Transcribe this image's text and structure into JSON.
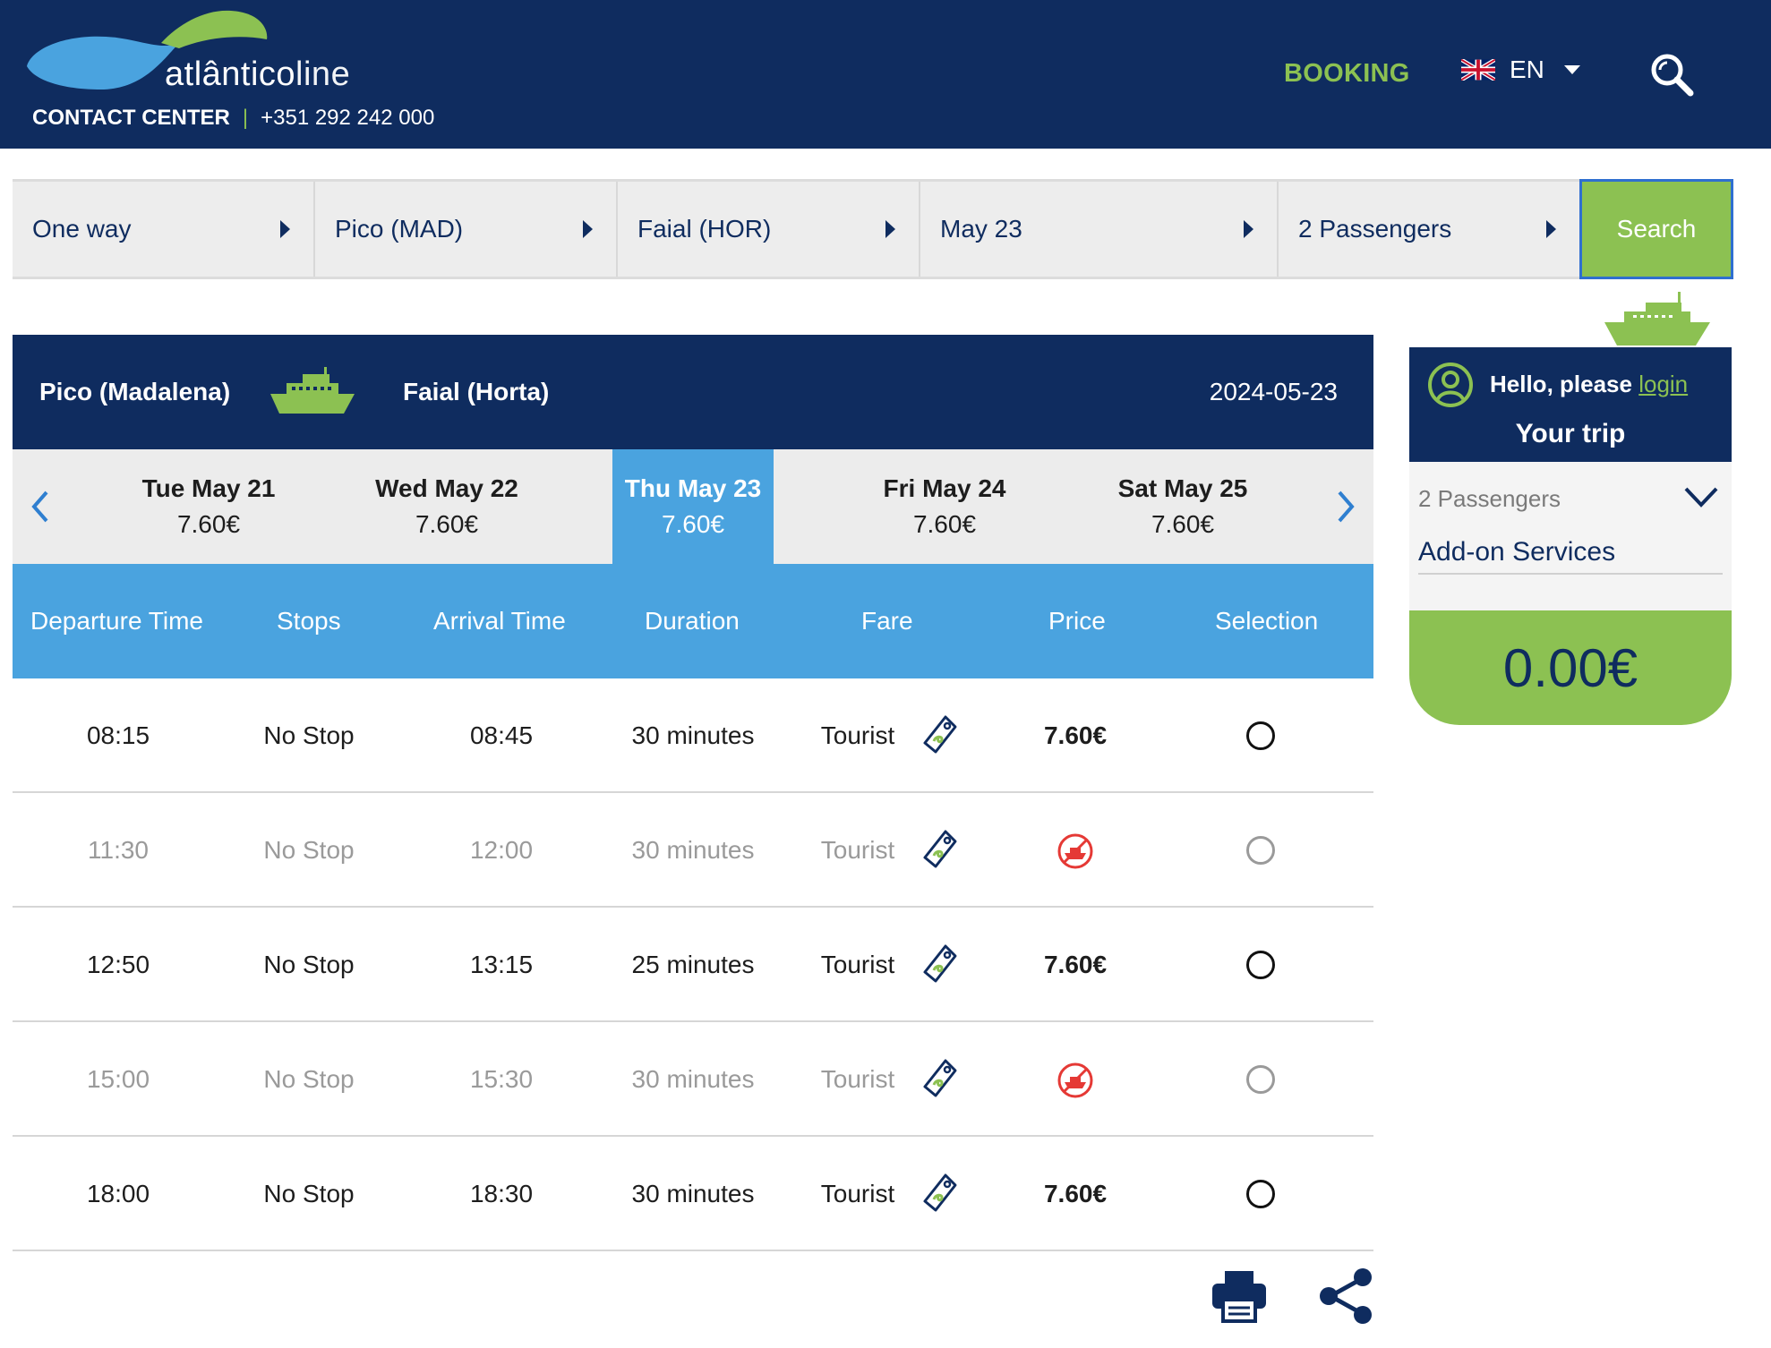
{
  "brand": {
    "logo_main": "atlântico",
    "logo_sub": "line"
  },
  "header": {
    "contact_label": "CONTACT CENTER",
    "contact_separator": "|",
    "contact_phone": "+351 292 242 000",
    "booking_label": "BOOKING",
    "language": "EN",
    "colors": {
      "navy": "#0f2c5f",
      "green": "#8cc152",
      "blue": "#4aa3df"
    }
  },
  "search_bar": {
    "trip_type": "One way",
    "origin": "Pico (MAD)",
    "destination": "Faial (HOR)",
    "date": "May 23",
    "passengers": "2 Passengers",
    "search_label": "Search"
  },
  "route": {
    "from": "Pico (Madalena)",
    "to": "Faial (Horta)",
    "date": "2024-05-23"
  },
  "dates": [
    {
      "day": "Tue May 21",
      "price": "7.60€",
      "active": false
    },
    {
      "day": "Wed May 22",
      "price": "7.60€",
      "active": false
    },
    {
      "day": "Thu May 23",
      "price": "7.60€",
      "active": true
    },
    {
      "day": "Fri May 24",
      "price": "7.60€",
      "active": false
    },
    {
      "day": "Sat May 25",
      "price": "7.60€",
      "active": false
    }
  ],
  "table": {
    "headers": [
      "Departure Time",
      "Stops",
      "Arrival Time",
      "Duration",
      "Fare",
      "Price",
      "Selection"
    ],
    "rows": [
      {
        "departure": "08:15",
        "stops": "No Stop",
        "arrival": "08:45",
        "duration": "30 minutes",
        "fare": "Tourist",
        "price": "7.60€",
        "available": true
      },
      {
        "departure": "11:30",
        "stops": "No Stop",
        "arrival": "12:00",
        "duration": "30 minutes",
        "fare": "Tourist",
        "price": "",
        "available": false
      },
      {
        "departure": "12:50",
        "stops": "No Stop",
        "arrival": "13:15",
        "duration": "25 minutes",
        "fare": "Tourist",
        "price": "7.60€",
        "available": true
      },
      {
        "departure": "15:00",
        "stops": "No Stop",
        "arrival": "15:30",
        "duration": "30 minutes",
        "fare": "Tourist",
        "price": "",
        "available": false
      },
      {
        "departure": "18:00",
        "stops": "No Stop",
        "arrival": "18:30",
        "duration": "30 minutes",
        "fare": "Tourist",
        "price": "7.60€",
        "available": true
      }
    ]
  },
  "sidebar": {
    "greeting": "Hello, please",
    "login_link": "login",
    "title": "Your trip",
    "passengers": "2 Passengers",
    "addons": "Add-on Services",
    "total": "0.00€"
  },
  "icons": [
    "search-icon",
    "flag-uk-icon",
    "chevron-down-icon",
    "ship-icon",
    "chevron-left-icon",
    "chevron-right-icon",
    "fare-tag-icon",
    "no-ship-icon",
    "user-icon",
    "print-icon",
    "share-icon"
  ]
}
